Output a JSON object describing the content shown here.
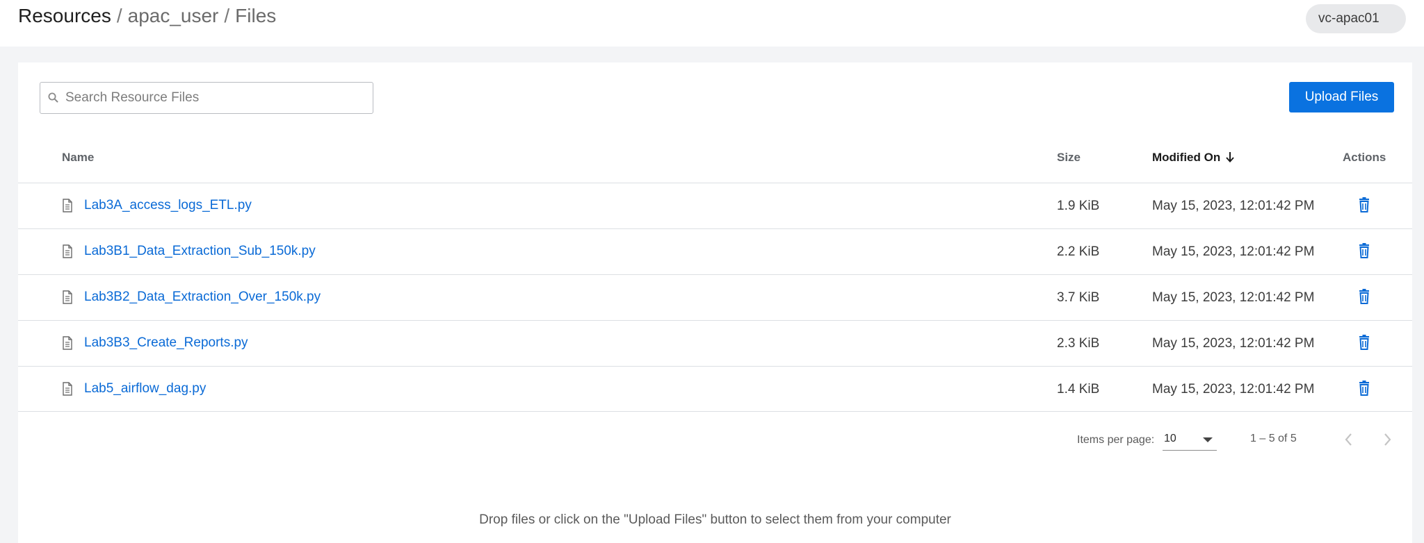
{
  "breadcrumb": {
    "root": "Resources",
    "separator": "/",
    "items": [
      "apac_user",
      "Files"
    ]
  },
  "environment": {
    "label": "vc-apac01"
  },
  "search": {
    "placeholder": "Search Resource Files",
    "value": ""
  },
  "toolbar": {
    "upload_label": "Upload Files"
  },
  "table": {
    "columns": {
      "name": "Name",
      "size": "Size",
      "modified": "Modified On",
      "actions": "Actions"
    },
    "sort": {
      "column": "Modified On",
      "direction": "descending"
    },
    "rows": [
      {
        "name": "Lab3A_access_logs_ETL.py",
        "size": "1.9 KiB",
        "modified": "May 15, 2023, 12:01:42 PM"
      },
      {
        "name": "Lab3B1_Data_Extraction_Sub_150k.py",
        "size": "2.2 KiB",
        "modified": "May 15, 2023, 12:01:42 PM"
      },
      {
        "name": "Lab3B2_Data_Extraction_Over_150k.py",
        "size": "3.7 KiB",
        "modified": "May 15, 2023, 12:01:42 PM"
      },
      {
        "name": "Lab3B3_Create_Reports.py",
        "size": "2.3 KiB",
        "modified": "May 15, 2023, 12:01:42 PM"
      },
      {
        "name": "Lab5_airflow_dag.py",
        "size": "1.4 KiB",
        "modified": "May 15, 2023, 12:01:42 PM"
      }
    ]
  },
  "paginator": {
    "items_per_page_label": "Items per page:",
    "items_per_page": "10",
    "range_label": "1 – 5 of 5"
  },
  "drop_hint": "Drop files or click on the \"Upload Files\" button to select them from your computer",
  "colors": {
    "accent": "#0a72e0",
    "link": "#0a6ad6",
    "background": "#f3f4f6"
  }
}
